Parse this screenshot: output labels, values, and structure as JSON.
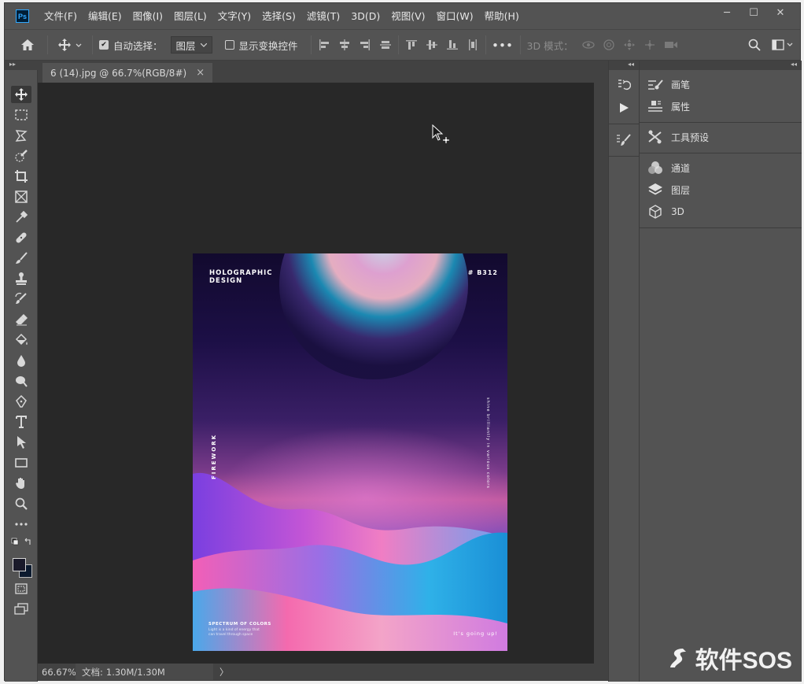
{
  "app": {
    "logo": "Ps"
  },
  "menu": [
    "文件(F)",
    "编辑(E)",
    "图像(I)",
    "图层(L)",
    "文字(Y)",
    "选择(S)",
    "滤镜(T)",
    "3D(D)",
    "视图(V)",
    "窗口(W)",
    "帮助(H)"
  ],
  "window_controls": {
    "minimize": "─",
    "maximize": "☐",
    "close": "✕"
  },
  "options": {
    "auto_select_label": "自动选择：",
    "auto_select_checked": true,
    "auto_select_value": "图层",
    "show_transform_label": "显示变换控件",
    "show_transform_checked": false,
    "more": "•••",
    "mode_3d_label": "3D 模式："
  },
  "document": {
    "tab_title": "6 (14).jpg @ 66.7%(RGB/8#)",
    "tab_close": "×",
    "zoom": "66.67%",
    "doc_label": "文档:",
    "doc_size": "1.30M/1.30M",
    "status_arrow": "〉"
  },
  "artwork": {
    "title_line1": "HOLOGRAPHIC",
    "title_line2": "DESIGN",
    "code": "# B312",
    "side_left": "FIREWORK",
    "side_right": "shine brilliantly in various colors",
    "footer_title": "SPECTRUM OF COLORS",
    "footer_line1": "Light is a kind of energy that",
    "footer_line2": "can travel through space",
    "footer_right": "It's going up!"
  },
  "panels": {
    "group1": [
      {
        "icon": "brush-settings-icon",
        "label": "画笔"
      },
      {
        "icon": "properties-icon",
        "label": "属性"
      }
    ],
    "group2": [
      {
        "icon": "tool-presets-icon",
        "label": "工具预设"
      }
    ],
    "group3": [
      {
        "icon": "channels-icon",
        "label": "通道"
      },
      {
        "icon": "layers-icon",
        "label": "图层"
      },
      {
        "icon": "3d-icon",
        "label": "3D"
      }
    ]
  },
  "watermark": {
    "text": "软件SOS"
  },
  "colors": {
    "foreground": "#1a1a2a",
    "background": "#0c1a2e",
    "accent": "#31a8ff"
  }
}
